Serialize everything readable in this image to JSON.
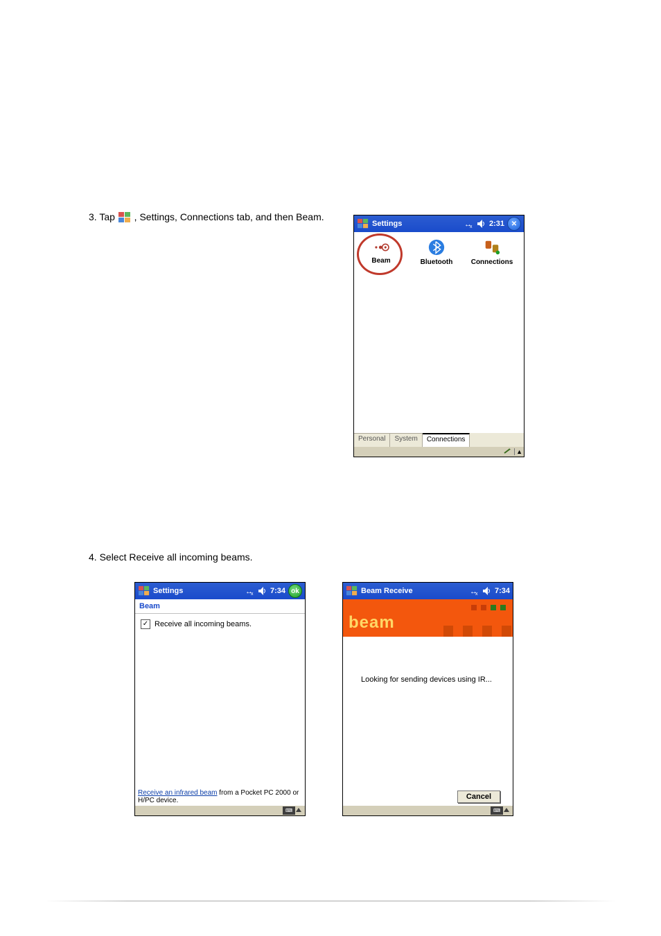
{
  "instruction_step3": {
    "prefix": "3. Tap ",
    "suffix": ", Settings, Connections tab, and then Beam."
  },
  "screen1": {
    "title": "Settings",
    "time": "2:31",
    "close_glyph": "✕",
    "icons": {
      "beam": "Beam",
      "bluetooth": "Bluetooth",
      "connections": "Connections"
    },
    "tabs": {
      "personal": "Personal",
      "system": "System",
      "connections": "Connections"
    }
  },
  "instruction_step4": "4. Select Receive all incoming beams.",
  "screen2": {
    "title": "Settings",
    "time": "7:34",
    "ok_label": "ok",
    "header": "Beam",
    "checkbox_label": "Receive all incoming beams.",
    "checkbox_checked": "✓",
    "footnote_link": "Receive an infrared beam",
    "footnote_rest": " from a Pocket PC 2000 or H/PC device."
  },
  "screen3": {
    "title": "Beam Receive",
    "time": "7:34",
    "banner_word": "beam",
    "status": "Looking for sending devices using IR...",
    "cancel": "Cancel"
  }
}
